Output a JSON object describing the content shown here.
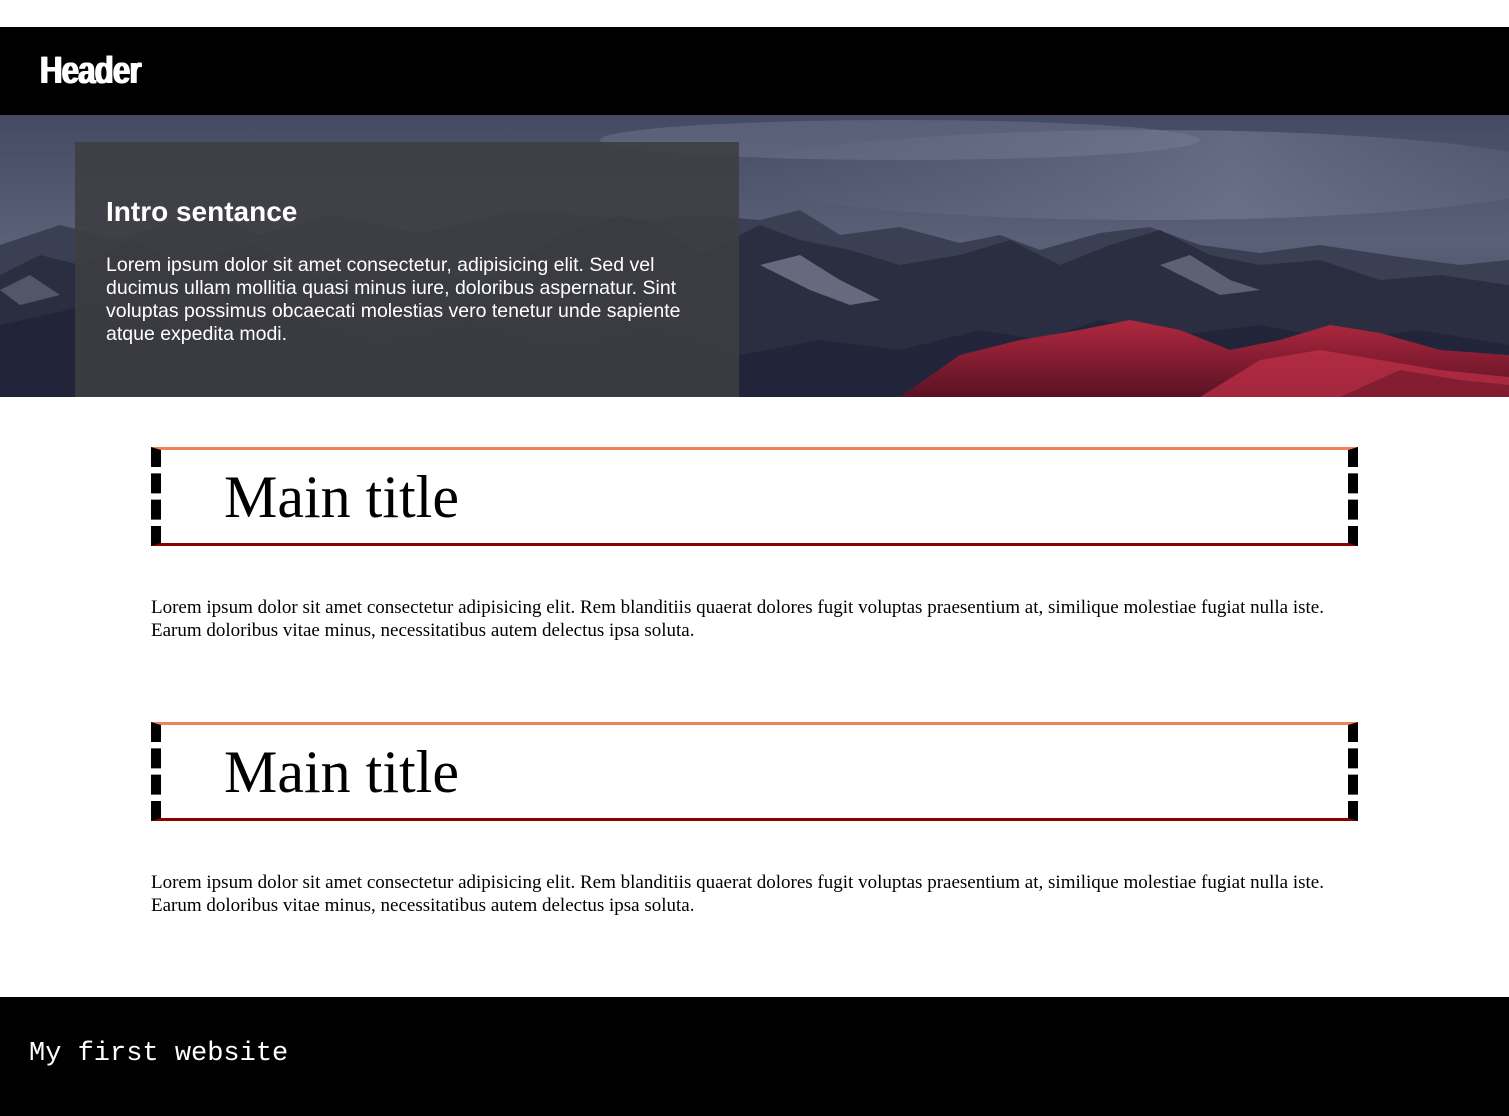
{
  "header": {
    "title": "Header"
  },
  "hero": {
    "intro_title": "Intro sentance",
    "intro_text": "Lorem ipsum dolor sit amet consectetur, adipisicing elit. Sed vel ducimus ullam mollitia quasi minus iure, doloribus aspernatur. Sint voluptas possimus obcaecati molestias vero tenetur unde sapiente atque expedita modi."
  },
  "sections": [
    {
      "title": "Main title",
      "text": "Lorem ipsum dolor sit amet consectetur adipisicing elit. Rem blanditiis quaerat dolores fugit voluptas praesentium at, similique molestiae fugiat nulla iste. Earum doloribus vitae minus, necessitatibus autem delectus ipsa soluta."
    },
    {
      "title": "Main title",
      "text": "Lorem ipsum dolor sit amet consectetur adipisicing elit. Rem blanditiis quaerat dolores fugit voluptas praesentium at, similique molestiae fugiat nulla iste. Earum doloribus vitae minus, necessitatibus autem delectus ipsa soluta."
    }
  ],
  "footer": {
    "text": "My first website"
  },
  "colors": {
    "header_bg": "#000000",
    "title_border_top": "#ef8358",
    "title_border_bottom": "#8b0000",
    "footer_bg": "#000000"
  }
}
